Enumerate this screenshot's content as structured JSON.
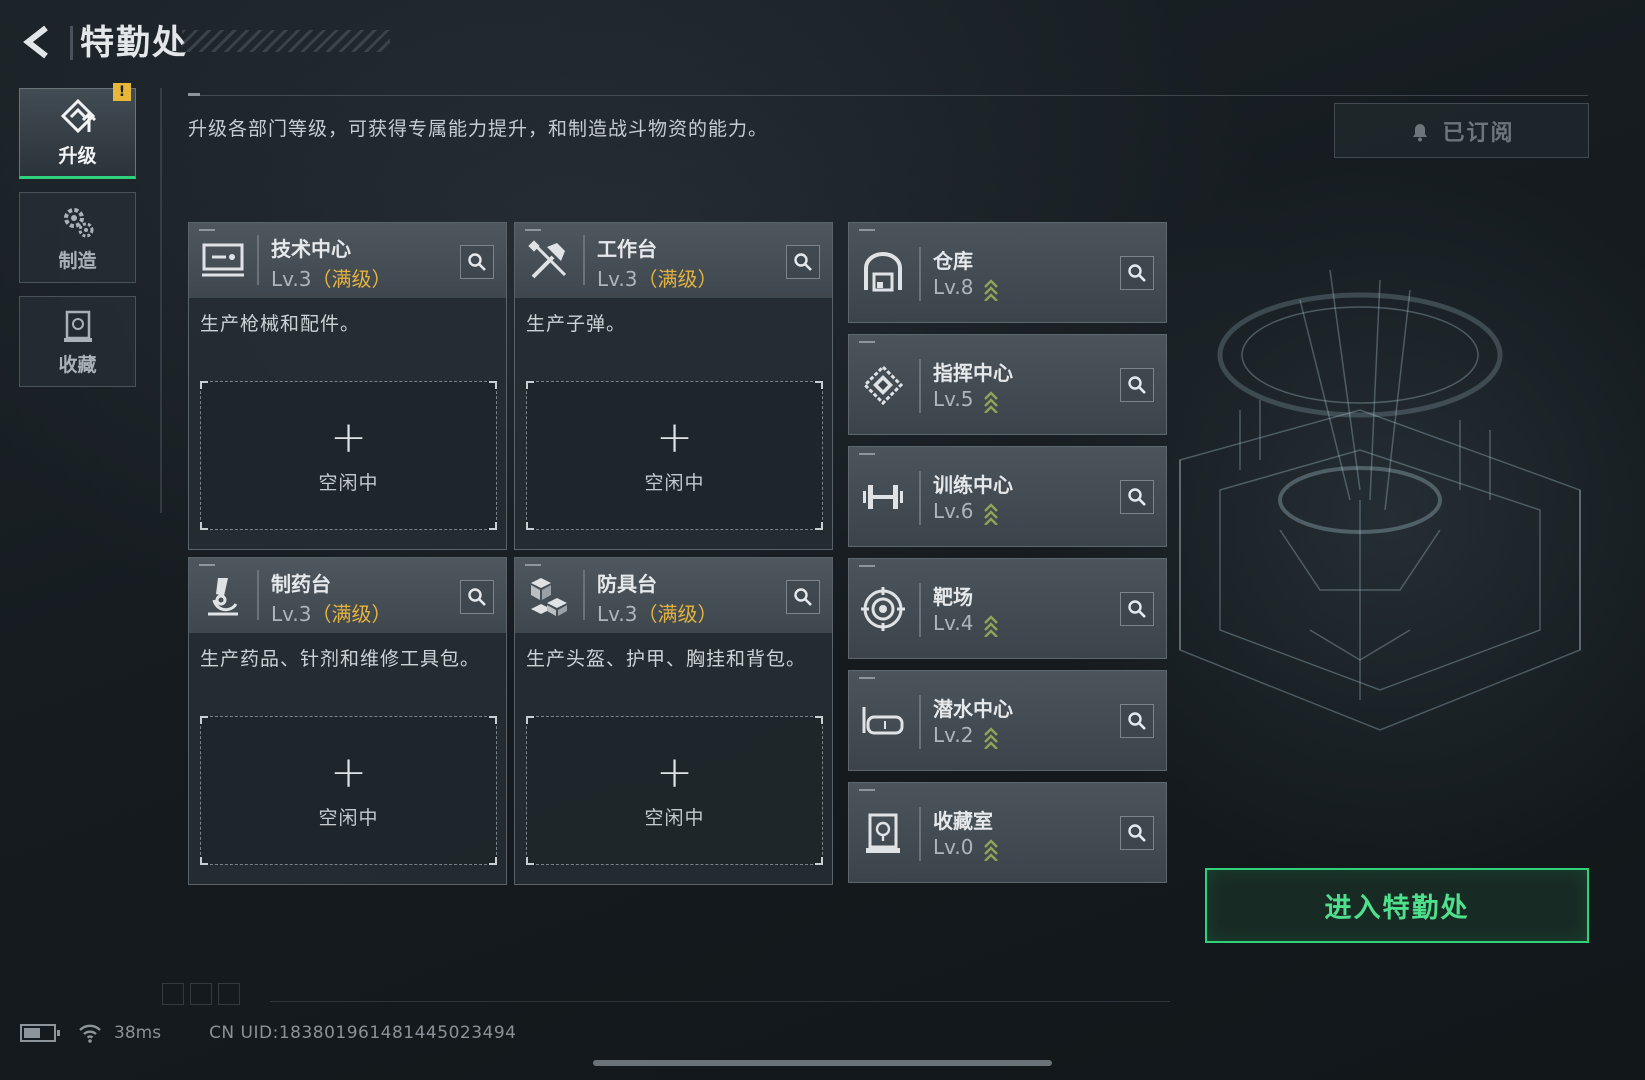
{
  "header": {
    "title": "特勤处"
  },
  "side_tabs": [
    {
      "label": "升级",
      "active": true,
      "alert": "!",
      "icon": "upgrade-icon"
    },
    {
      "label": "制造",
      "active": false,
      "icon": "gears-icon"
    },
    {
      "label": "收藏",
      "active": false,
      "icon": "collection-icon"
    }
  ],
  "description": "升级各部门等级，可获得专属能力提升，和制造战斗物资的能力。",
  "subscribe": {
    "label": "已订阅",
    "icon": "bell-icon"
  },
  "production_cards": [
    {
      "name": "技术中心",
      "level": "Lv.3",
      "maxed": "（满级）",
      "desc": "生产枪械和配件。",
      "slot_plus": "+",
      "slot_label": "空闲中",
      "icon": "tech-center-icon"
    },
    {
      "name": "工作台",
      "level": "Lv.3",
      "maxed": "（满级）",
      "desc": "生产子弹。",
      "slot_plus": "+",
      "slot_label": "空闲中",
      "icon": "tools-icon"
    },
    {
      "name": "制药台",
      "level": "Lv.3",
      "maxed": "（满级）",
      "desc": "生产药品、针剂和维修工具包。",
      "slot_plus": "+",
      "slot_label": "空闲中",
      "icon": "microscope-icon"
    },
    {
      "name": "防具台",
      "level": "Lv.3",
      "maxed": "（满级）",
      "desc": "生产头盔、护甲、胸挂和背包。",
      "slot_plus": "+",
      "slot_label": "空闲中",
      "icon": "armor-blocks-icon"
    }
  ],
  "facilities": [
    {
      "name": "仓库",
      "level": "Lv.8",
      "icon": "warehouse-icon"
    },
    {
      "name": "指挥中心",
      "level": "Lv.5",
      "icon": "command-chip-icon"
    },
    {
      "name": "训练中心",
      "level": "Lv.6",
      "icon": "dumbbell-icon"
    },
    {
      "name": "靶场",
      "level": "Lv.4",
      "icon": "target-icon"
    },
    {
      "name": "潜水中心",
      "level": "Lv.2",
      "icon": "diving-mask-icon"
    },
    {
      "name": "收藏室",
      "level": "Lv.0",
      "icon": "trophy-case-icon"
    }
  ],
  "enter_button": {
    "label": "进入特勤处"
  },
  "status": {
    "ping": "38ms",
    "uid": "CN UID:1838019614814450234​94"
  },
  "colors": {
    "accent_green": "#2fd17a",
    "maxed_gold": "#e4b23e",
    "upgrade_chevron": "#8fa35a"
  }
}
